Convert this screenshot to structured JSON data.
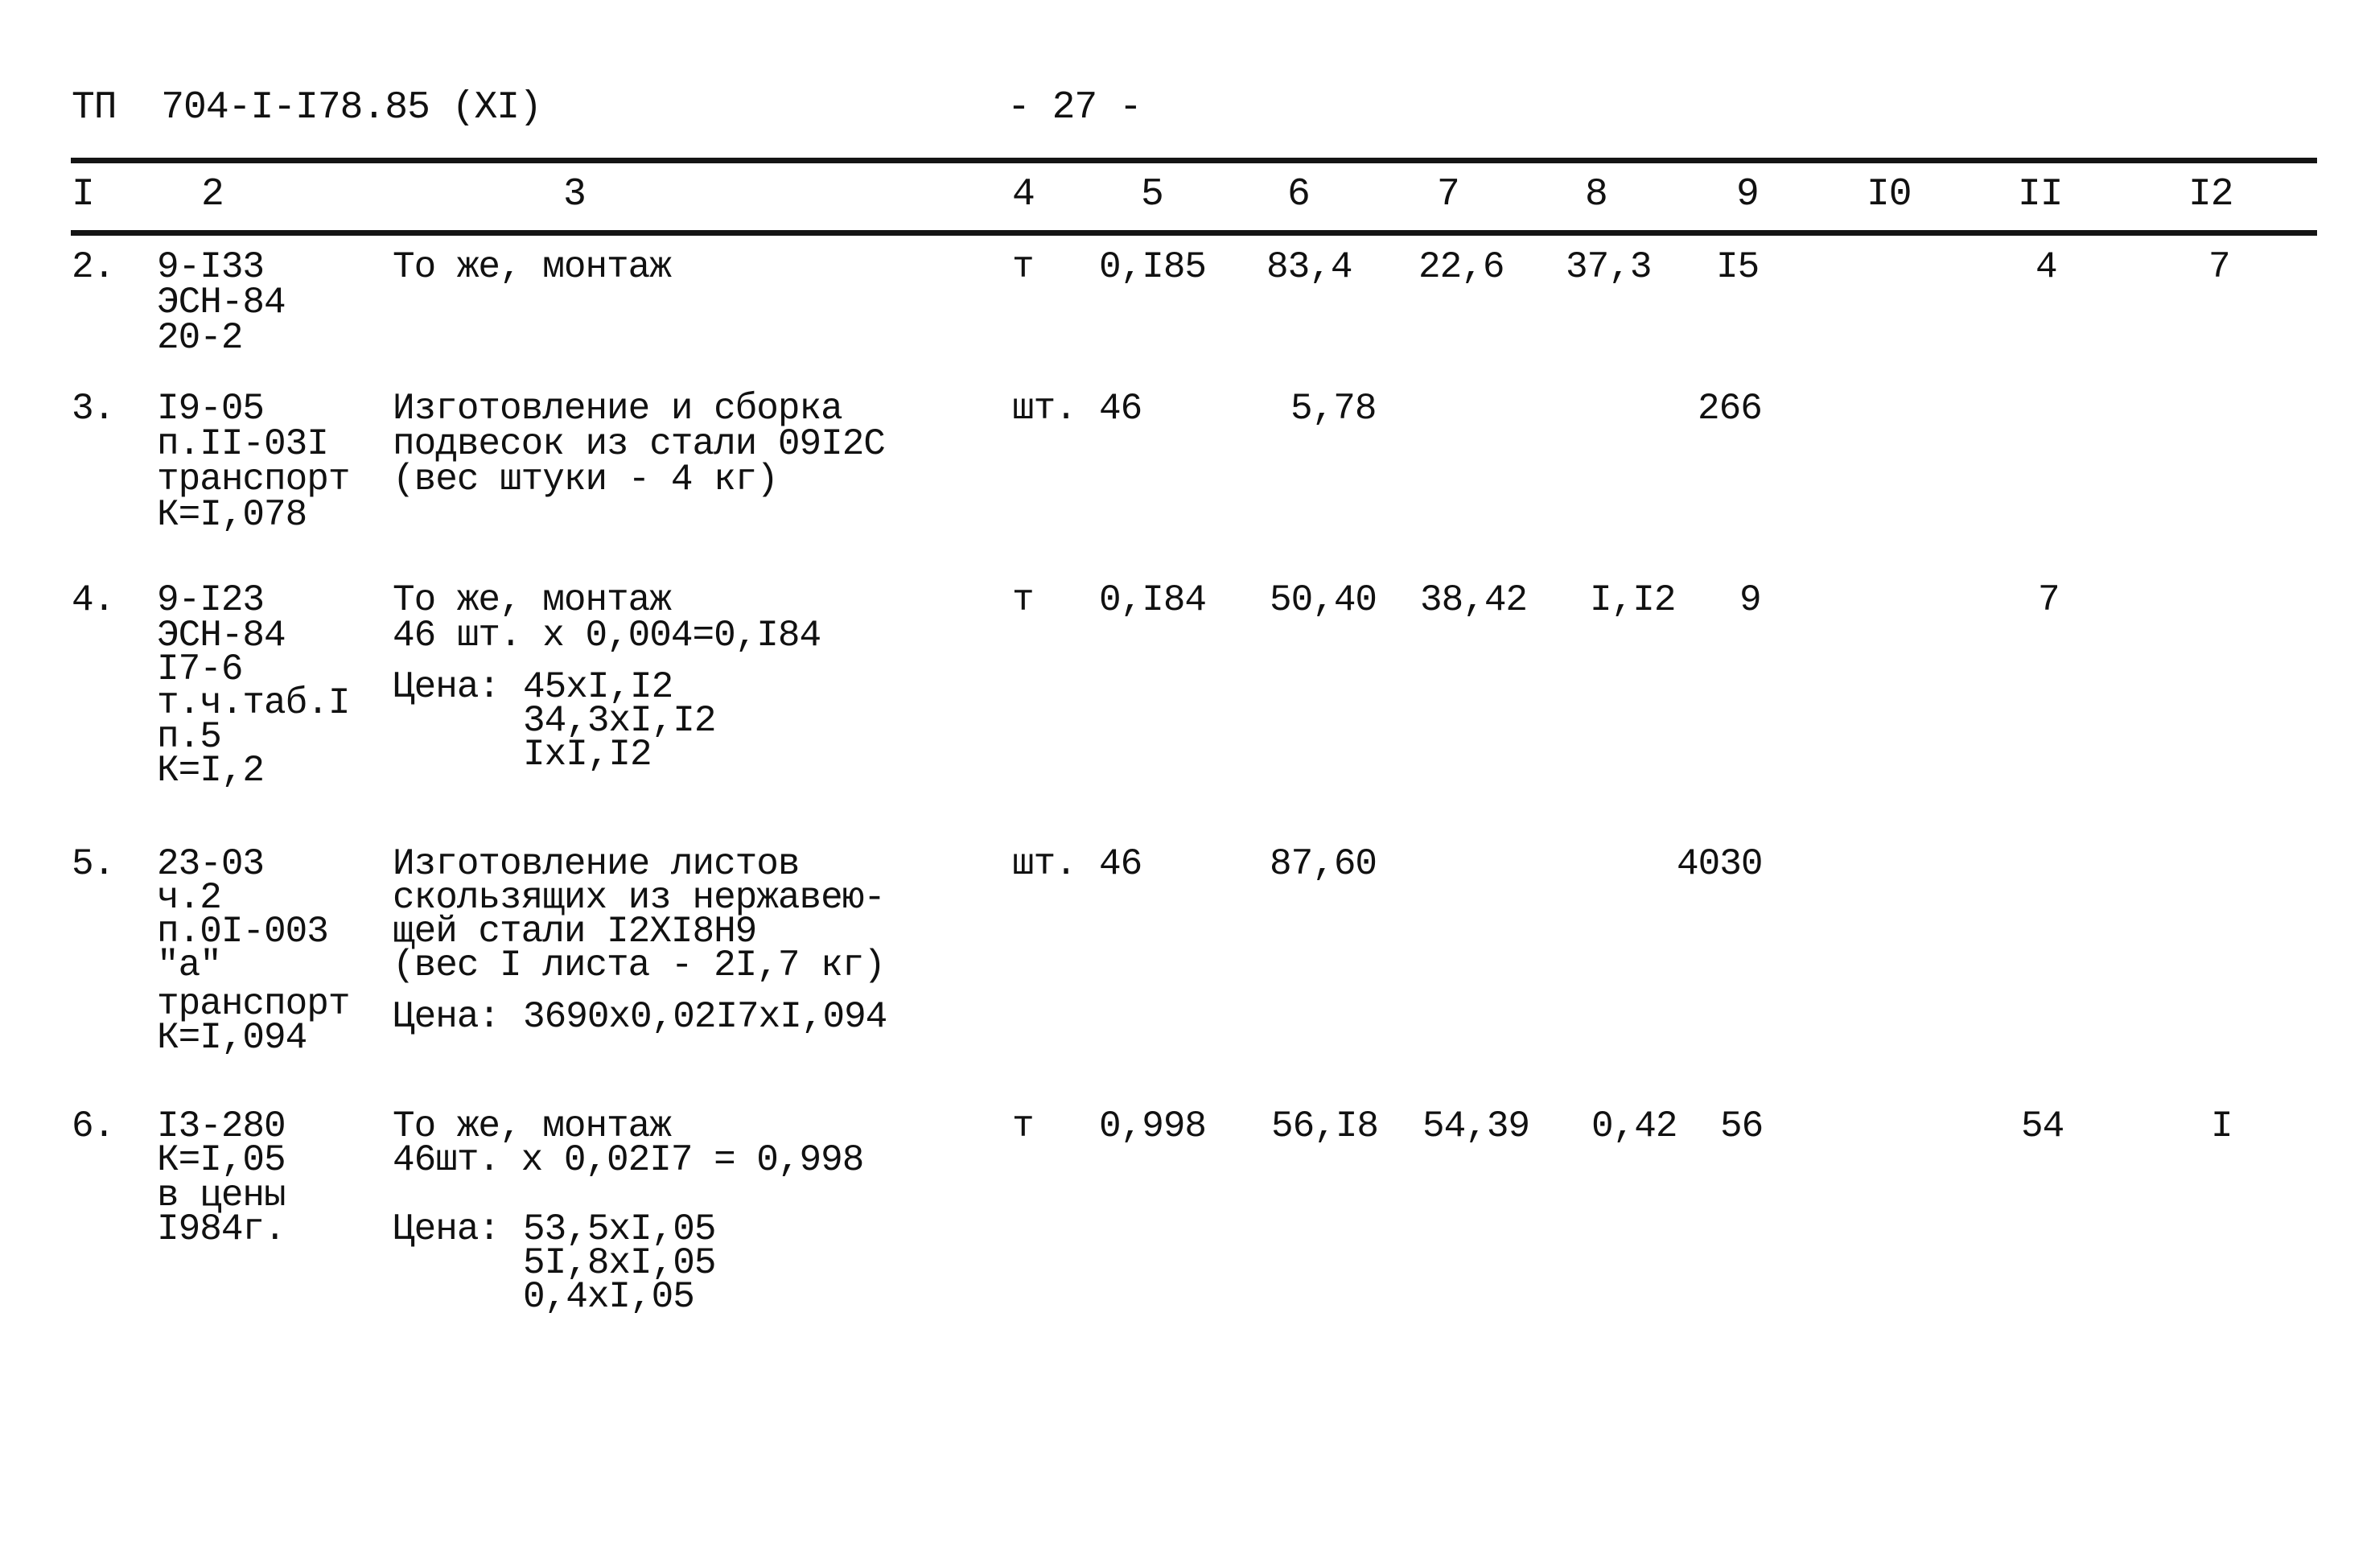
{
  "page_header": {
    "doc_code": "ТП  704-I-I78.85 (XI)",
    "page_number": "- 27 -"
  },
  "table": {
    "columns": [
      "I",
      "2",
      "3",
      "4",
      "5",
      "6",
      "7",
      "8",
      "9",
      "I0",
      "II",
      "I2"
    ],
    "rows": [
      {
        "no": "2.",
        "code": [
          "9-I33",
          "ЭСН-84",
          "20-2"
        ],
        "desc": [
          "То же, монтаж"
        ],
        "price_calc": [],
        "unit": "т",
        "c5": "0,I85",
        "c6": "83,4",
        "c7": "22,6",
        "c8": "37,3",
        "c9": "I5",
        "c10": "",
        "c11": "4",
        "c12": "7"
      },
      {
        "no": "3.",
        "code": [
          "I9-05",
          "п.II-03I",
          "транспорт",
          "К=I,078"
        ],
        "desc": [
          "Изготовление и сборка",
          "подвесок из стали 09I2С",
          "(вес штуки - 4 кг)"
        ],
        "price_calc": [],
        "unit": "шт.",
        "c5": "46",
        "c6": "5,78",
        "c7": "",
        "c8": "",
        "c9": "266",
        "c10": "",
        "c11": "",
        "c12": ""
      },
      {
        "no": "4.",
        "code": [
          "9-I23",
          "ЭСН-84",
          "I7-6",
          "т.ч.таб.I",
          "п.5",
          "К=I,2"
        ],
        "desc": [
          "То же, монтаж",
          "46 шт. х 0,004=0,I84"
        ],
        "price_label": "Цена:",
        "price_calc": [
          "45хI,I2",
          "34,3хI,I2",
          "IхI,I2"
        ],
        "unit": "т",
        "c5": "0,I84",
        "c6": "50,40",
        "c7": "38,42",
        "c8": "I,I2",
        "c9": "9",
        "c10": "",
        "c11": "7",
        "c12": ""
      },
      {
        "no": "5.",
        "code": [
          "23-03",
          "ч.2",
          "п.0I-003",
          "\"а\"",
          "транспорт",
          "К=I,094"
        ],
        "desc": [
          "Изготовление листов",
          "скользящих из нержавею-",
          "щей стали I2ХI8Н9",
          "(вес I листа - 2I,7 кг)"
        ],
        "price_label": "Цена:",
        "price_calc": [
          "3690х0,02I7хI,094"
        ],
        "unit": "шт.",
        "c5": "46",
        "c6": "87,60",
        "c7": "",
        "c8": "",
        "c9": "4030",
        "c10": "",
        "c11": "",
        "c12": ""
      },
      {
        "no": "6.",
        "code": [
          "I3-280",
          "К=I,05",
          "в цены",
          "I984г."
        ],
        "desc": [
          "То же, монтаж",
          "46шт. х 0,02I7 = 0,998"
        ],
        "price_label": "Цена:",
        "price_calc": [
          "53,5хI,05",
          "5I,8хI,05",
          "0,4хI,05"
        ],
        "unit": "т",
        "c5": "0,998",
        "c6": "56,I8",
        "c7": "54,39",
        "c8": "0,42",
        "c9": "56",
        "c10": "",
        "c11": "54",
        "c12": "I"
      }
    ]
  }
}
